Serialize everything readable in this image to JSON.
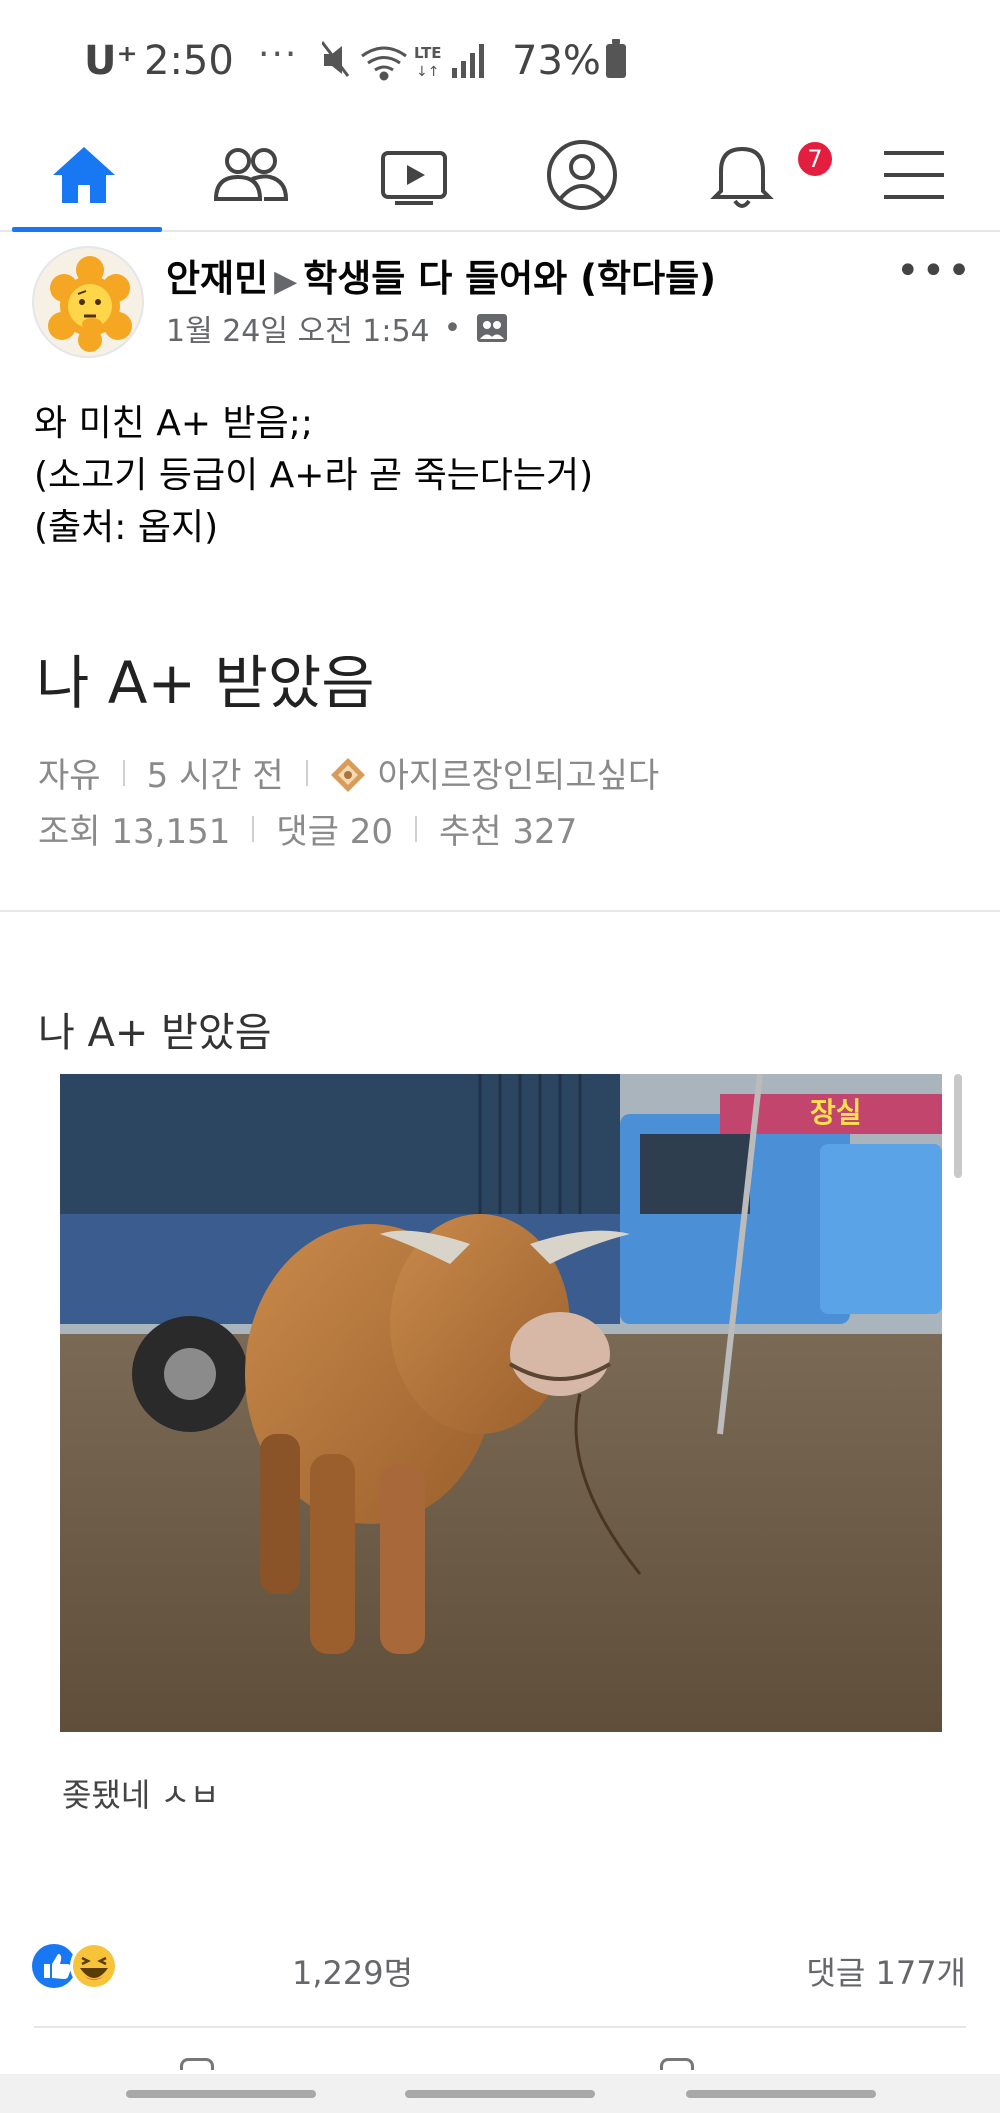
{
  "status_bar": {
    "carrier": "U⁺",
    "time": "2:50",
    "overflow": "···",
    "battery": "73%",
    "icons": [
      "mute-icon",
      "wifi-icon",
      "lte-icon",
      "signal-icon",
      "battery-icon"
    ]
  },
  "nav": {
    "items": [
      {
        "name": "home",
        "icon": "home-icon",
        "active": true
      },
      {
        "name": "friends",
        "icon": "friends-icon"
      },
      {
        "name": "watch",
        "icon": "video-icon"
      },
      {
        "name": "profile",
        "icon": "profile-icon"
      },
      {
        "name": "notifications",
        "icon": "bell-icon",
        "badge": "7"
      },
      {
        "name": "menu",
        "icon": "menu-icon"
      }
    ],
    "accent": "#1877f2",
    "badge_color": "#e41e3f"
  },
  "post": {
    "author": "안재민",
    "group": "학생들 다 들어와 (학다들)",
    "timestamp": "1월 24일 오전 1:54",
    "dot": "•",
    "more": "•••",
    "caption": [
      "와 미친 A+ 받음;;",
      "(소고기 등급이 A+라 곧 죽는다는거)",
      "(출처: 옵지)"
    ]
  },
  "community": {
    "title": "나 A+ 받았음",
    "board": "자유",
    "time_ago": "5 시간 전",
    "nickname": "아지르장인되고싶다",
    "views": "조회 13,151",
    "comments": "댓글 20",
    "likes": "추천 327",
    "body_title": "나 A+ 받았음",
    "photo_caption": "좆됐네 ㅅㅂ"
  },
  "engagement": {
    "reaction_icons": [
      "like-icon",
      "haha-icon"
    ],
    "reaction_count": "1,229명",
    "comment_count": "댓글 177개"
  }
}
